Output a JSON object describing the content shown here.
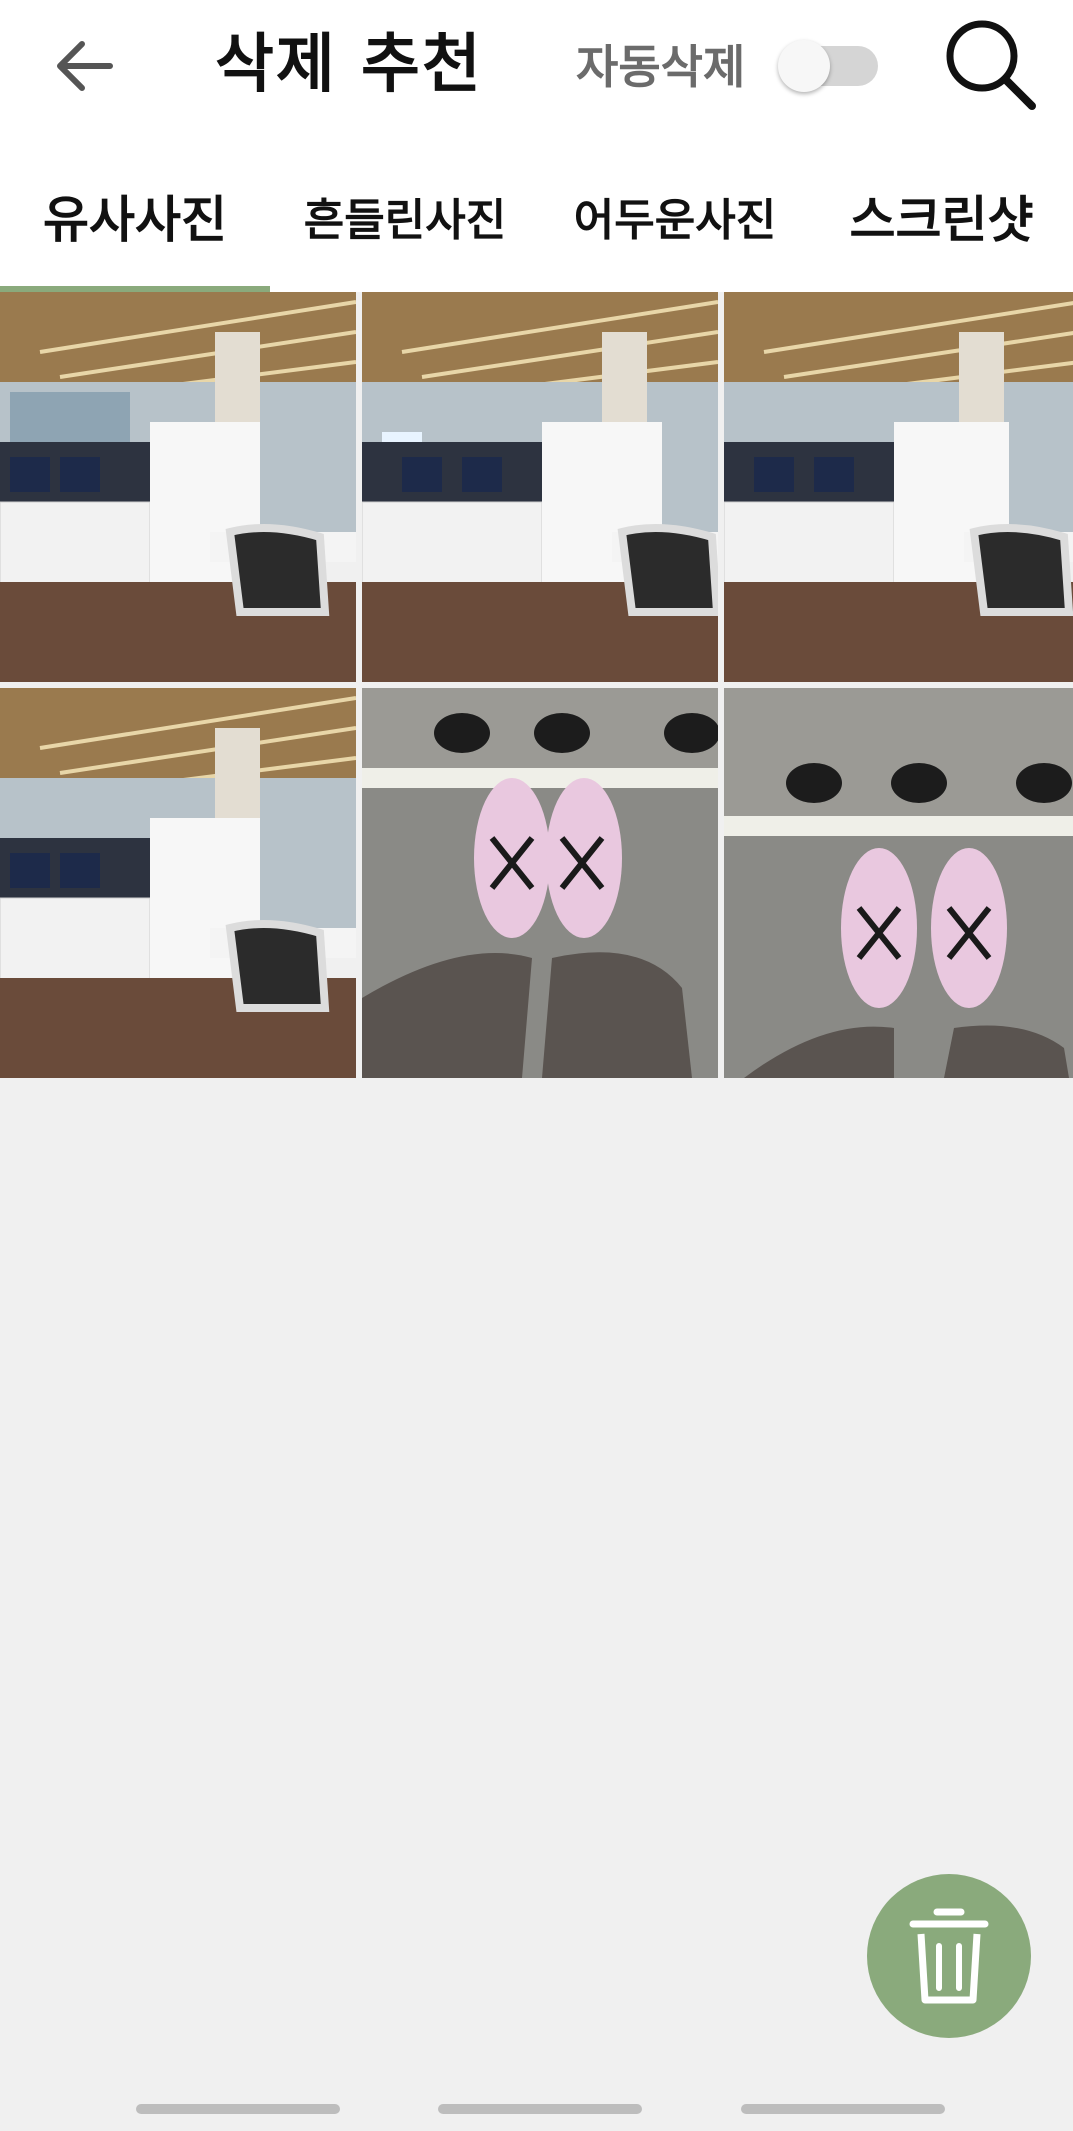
{
  "header": {
    "title": "삭제 추천",
    "auto_delete_label": "자동삭제",
    "auto_delete_on": false
  },
  "tabs": [
    {
      "label": "유사사진",
      "active": true
    },
    {
      "label": "흔들린사진",
      "active": false
    },
    {
      "label": "어두운사진",
      "active": false
    },
    {
      "label": "스크린샷",
      "active": false
    }
  ],
  "photos": [
    {
      "subject": "office-interior"
    },
    {
      "subject": "office-interior"
    },
    {
      "subject": "office-interior"
    },
    {
      "subject": "office-interior"
    },
    {
      "subject": "sneakers-pink"
    },
    {
      "subject": "sneakers-pink"
    }
  ],
  "colors": {
    "accent": "#8aaa7c",
    "background": "#f0f0f0"
  },
  "icons": {
    "back": "arrow-left-icon",
    "search": "search-icon",
    "delete": "trash-icon"
  }
}
